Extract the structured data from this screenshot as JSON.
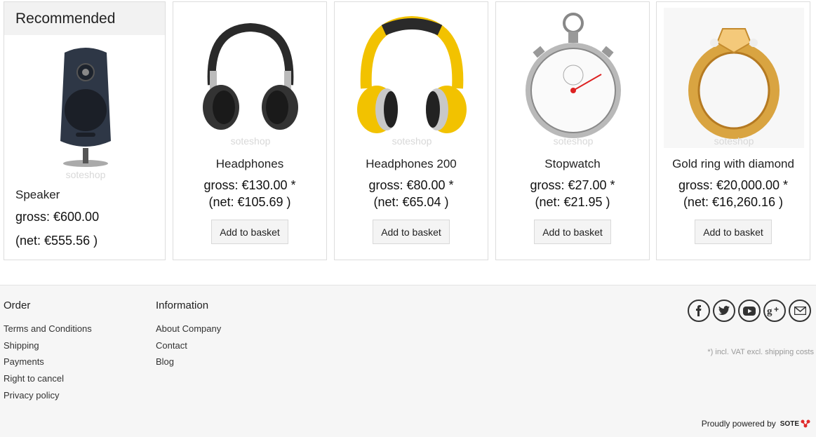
{
  "recommended": {
    "title": "Recommended",
    "product": {
      "name": "Speaker",
      "gross": "gross: €600.00",
      "net": "(net: €555.56 )",
      "watermark": "soteshop"
    }
  },
  "products": [
    {
      "name": "Headphones",
      "gross": "gross: €130.00 *",
      "net": "(net: €105.69 )",
      "button": "Add to basket",
      "watermark": "soteshop"
    },
    {
      "name": "Headphones 200",
      "gross": "gross: €80.00 *",
      "net": "(net: €65.04 )",
      "button": "Add to basket",
      "watermark": "soteshop"
    },
    {
      "name": "Stopwatch",
      "gross": "gross: €27.00 *",
      "net": "(net: €21.95 )",
      "button": "Add to basket",
      "watermark": "soteshop"
    },
    {
      "name": "Gold ring with diamond",
      "gross": "gross: €20,000.00 *",
      "net": "(net: €16,260.16 )",
      "button": "Add to basket",
      "watermark": "soteshop"
    }
  ],
  "footer": {
    "order": {
      "title": "Order",
      "links": [
        "Terms and Conditions",
        "Shipping",
        "Payments",
        "Right to cancel",
        "Privacy policy"
      ]
    },
    "information": {
      "title": "Information",
      "links": [
        "About Company",
        "Contact",
        "Blog"
      ]
    },
    "social": [
      "facebook-icon",
      "twitter-icon",
      "youtube-icon",
      "google-plus-icon",
      "mail-icon"
    ],
    "vat_note": "*) incl. VAT excl. shipping costs",
    "powered_by": "Proudly powered by",
    "brand": "SOTE"
  }
}
